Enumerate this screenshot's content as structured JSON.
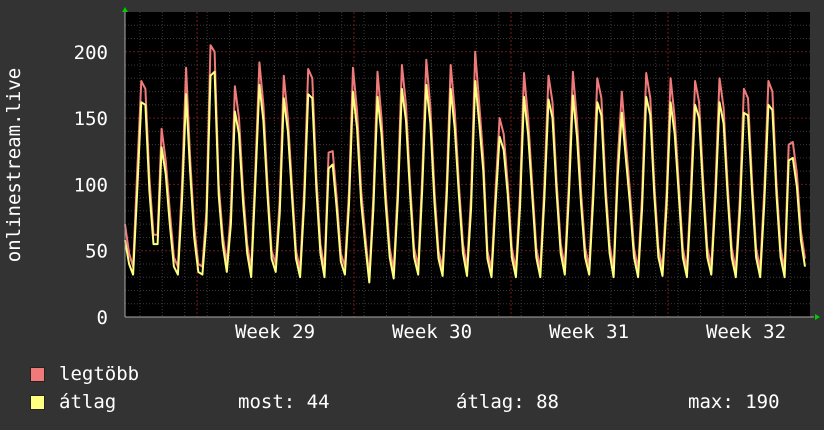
{
  "chart_data": {
    "type": "line",
    "ylabel": "onlinestream.live",
    "y_ticks": [
      "0",
      "50",
      "100",
      "150",
      "200"
    ],
    "ylim": [
      0,
      230
    ],
    "x_ticks": [
      "Week 29",
      "Week 30",
      "Week 31",
      "Week 32"
    ],
    "grid": true,
    "series": [
      {
        "name": "legtöbb",
        "color": "#f07a7a",
        "values": [
          70,
          48,
          38,
          110,
          178,
          172,
          105,
          62,
          62,
          142,
          118,
          80,
          45,
          38,
          100,
          188,
          120,
          68,
          40,
          38,
          80,
          205,
          200,
          100,
          62,
          40,
          80,
          174,
          150,
          95,
          55,
          36,
          110,
          192,
          160,
          100,
          50,
          40,
          88,
          182,
          150,
          100,
          50,
          36,
          96,
          187,
          180,
          105,
          55,
          36,
          124,
          125,
          90,
          48,
          38,
          95,
          188,
          155,
          95,
          62,
          30,
          92,
          185,
          150,
          95,
          52,
          35,
          98,
          190,
          160,
          102,
          52,
          38,
          106,
          194,
          158,
          95,
          50,
          37,
          100,
          190,
          155,
          100,
          55,
          37,
          92,
          200,
          160,
          120,
          50,
          36,
          95,
          150,
          138,
          100,
          52,
          36,
          93,
          184,
          150,
          100,
          52,
          36,
          100,
          182,
          162,
          102,
          55,
          38,
          100,
          185,
          148,
          95,
          52,
          38,
          100,
          180,
          165,
          100,
          55,
          36,
          118,
          170,
          132,
          95,
          52,
          36,
          92,
          184,
          165,
          100,
          52,
          37,
          94,
          180,
          150,
          100,
          52,
          36,
          100,
          178,
          162,
          102,
          52,
          38,
          98,
          180,
          158,
          100,
          52,
          36,
          90,
          172,
          165,
          102,
          52,
          36,
          96,
          178,
          170,
          100,
          52,
          36,
          130,
          132,
          108,
          65,
          44
        ]
      },
      {
        "name": "átlag",
        "color": "#ffff80",
        "values": [
          58,
          40,
          32,
          95,
          162,
          160,
          95,
          55,
          55,
          128,
          108,
          70,
          38,
          32,
          88,
          168,
          110,
          60,
          34,
          32,
          70,
          182,
          185,
          92,
          55,
          34,
          70,
          155,
          138,
          86,
          48,
          30,
          100,
          175,
          148,
          92,
          44,
          34,
          78,
          165,
          140,
          92,
          44,
          30,
          86,
          168,
          165,
          96,
          48,
          30,
          112,
          115,
          82,
          42,
          32,
          85,
          170,
          142,
          86,
          55,
          26,
          82,
          166,
          138,
          86,
          45,
          29,
          88,
          172,
          148,
          94,
          45,
          32,
          96,
          175,
          146,
          86,
          44,
          31,
          90,
          172,
          142,
          92,
          48,
          31,
          82,
          178,
          146,
          110,
          44,
          30,
          85,
          136,
          126,
          92,
          45,
          30,
          83,
          166,
          138,
          92,
          45,
          30,
          90,
          164,
          150,
          94,
          48,
          32,
          90,
          167,
          136,
          86,
          45,
          32,
          90,
          162,
          152,
          92,
          48,
          30,
          106,
          154,
          120,
          86,
          45,
          30,
          82,
          166,
          152,
          92,
          45,
          31,
          84,
          162,
          138,
          92,
          45,
          30,
          90,
          160,
          150,
          94,
          45,
          32,
          88,
          162,
          146,
          92,
          45,
          30,
          80,
          154,
          152,
          94,
          45,
          30,
          86,
          160,
          156,
          92,
          45,
          30,
          118,
          120,
          98,
          58,
          38
        ]
      }
    ]
  },
  "legend": {
    "items": [
      {
        "label": "legtöbb",
        "color": "#f07a7a"
      },
      {
        "label": "átlag",
        "color": "#ffff80"
      }
    ],
    "stats": {
      "now": "most: 44",
      "avg": "átlag: 88",
      "max": "max: 190"
    }
  },
  "colors": {
    "background": "#333333",
    "plot_background": "#000000",
    "text": "#ffffff",
    "axis_arrow": "#00cc00",
    "week_line": "#ff0000"
  }
}
